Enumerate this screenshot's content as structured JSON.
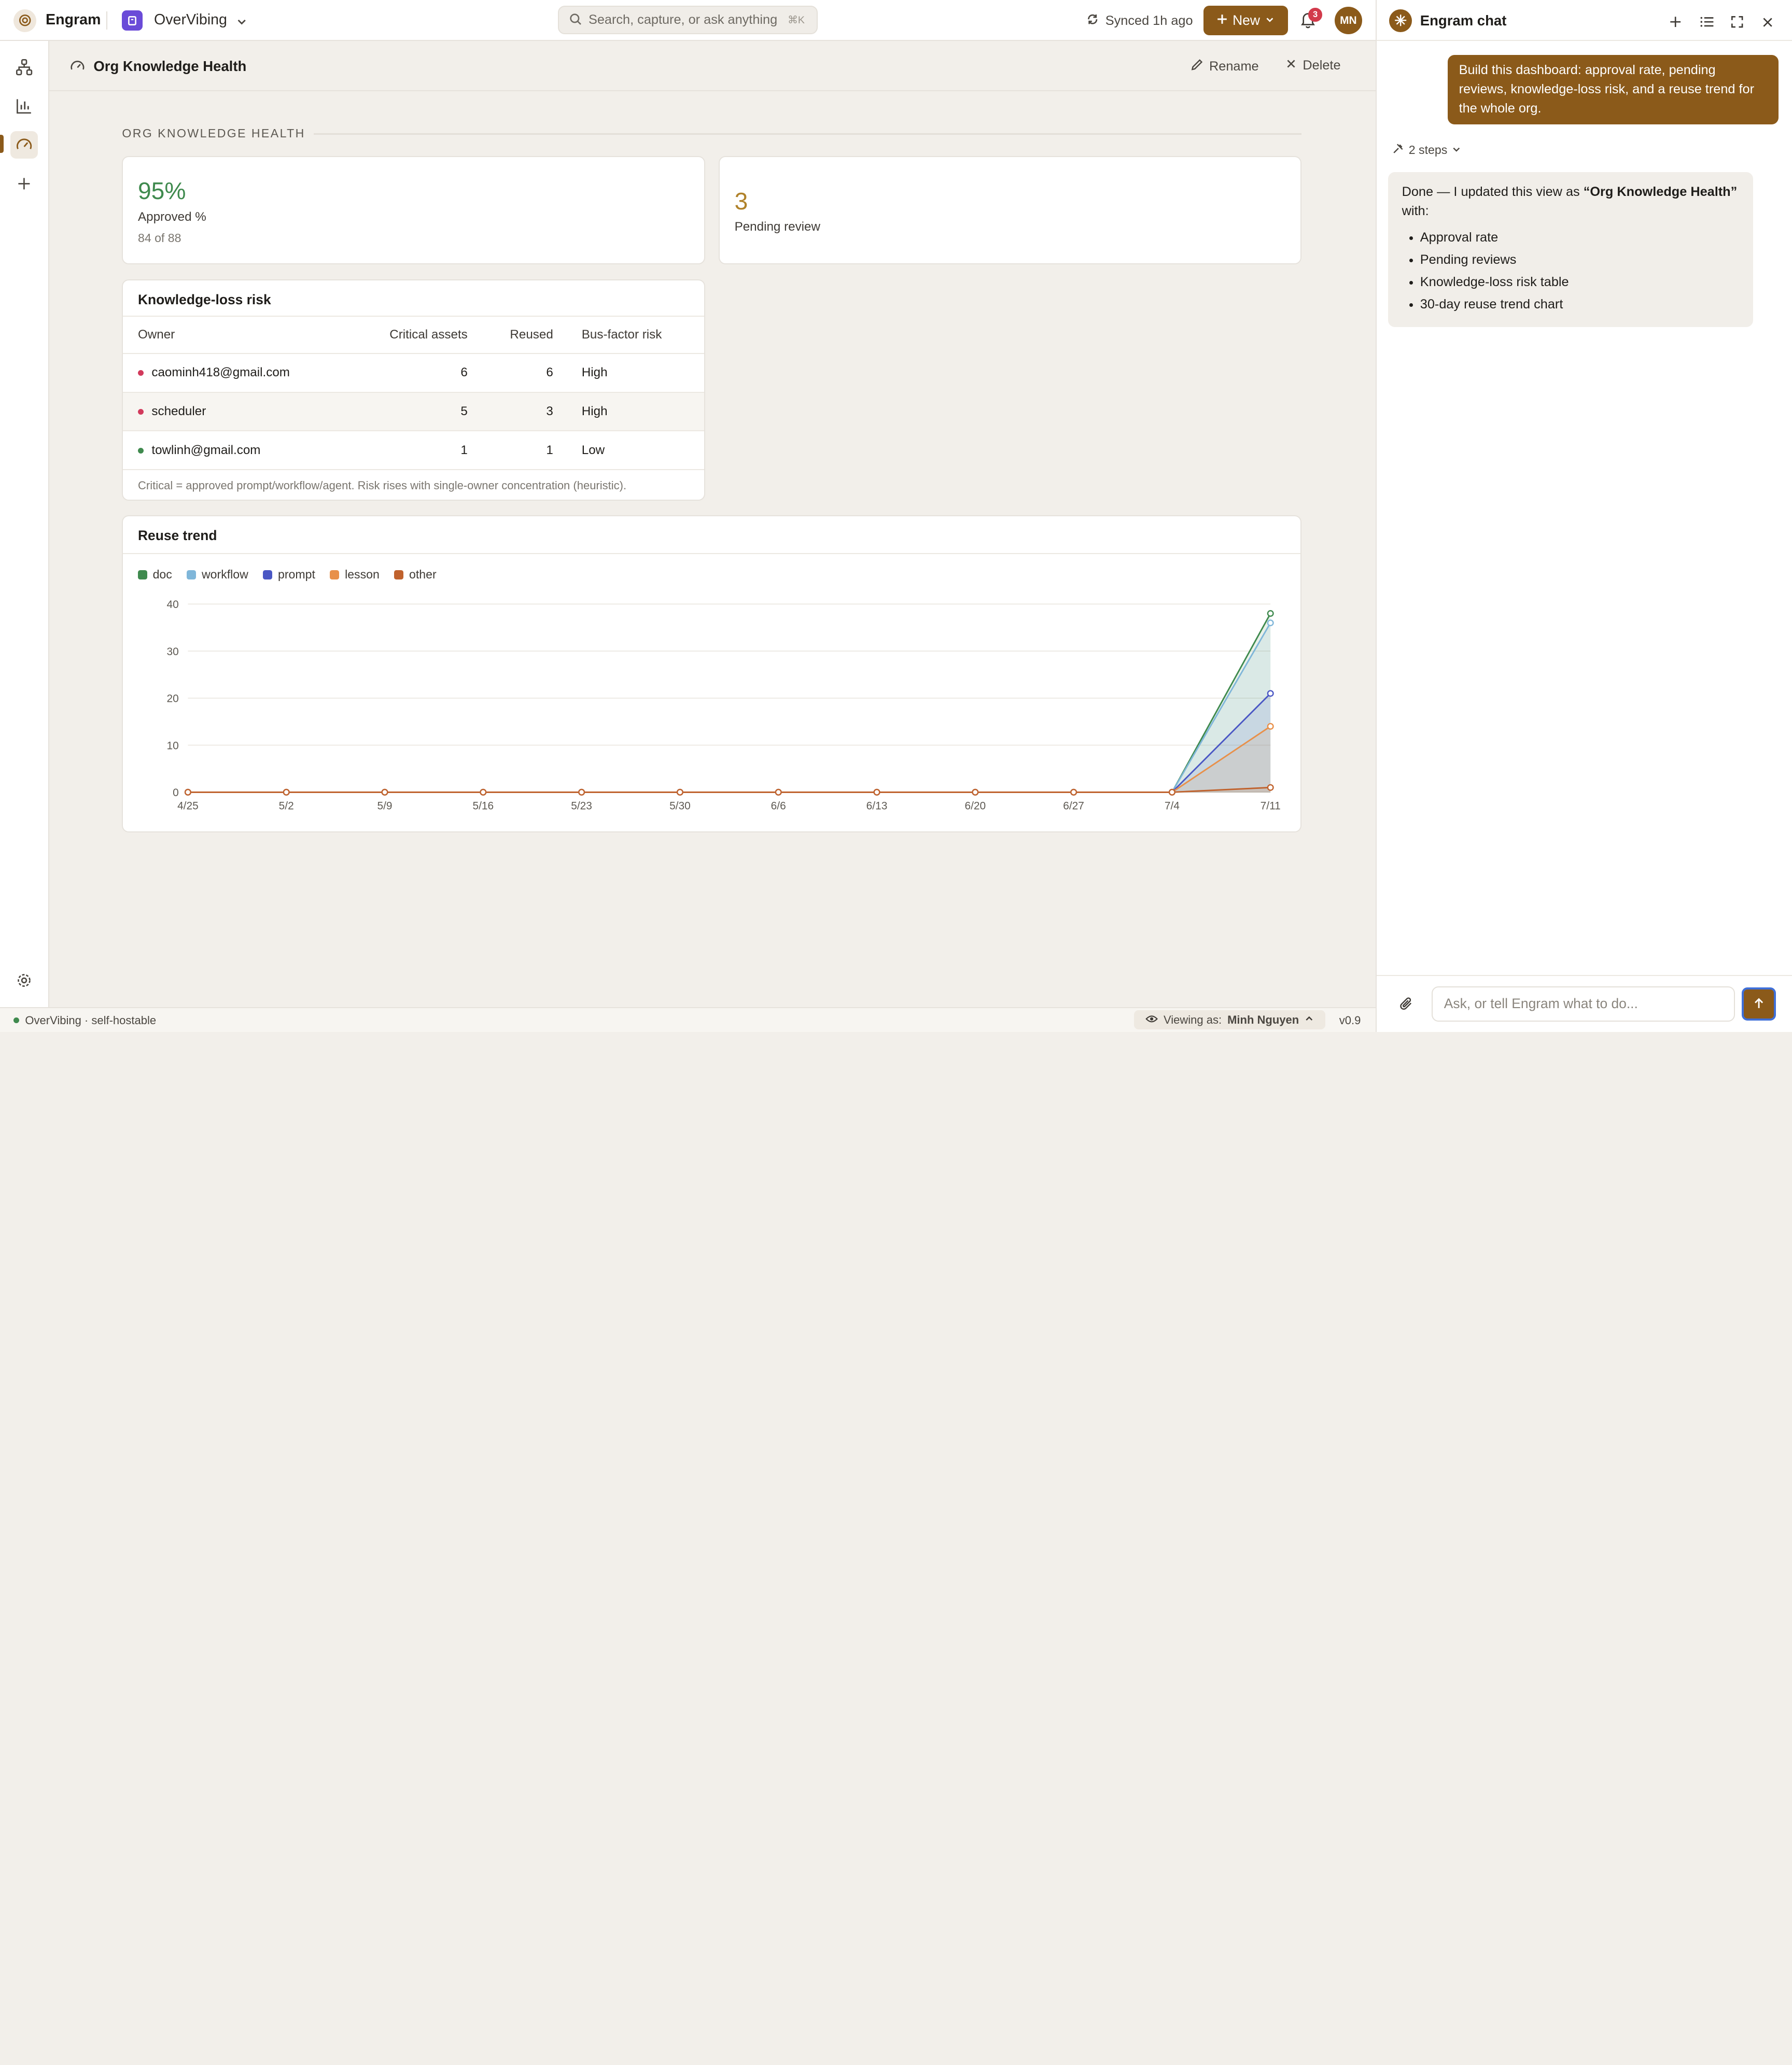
{
  "topbar": {
    "brand": "Engram",
    "workspace": "OverVibing",
    "search_placeholder": "Search, capture, or ask anything",
    "search_shortcut": "⌘K",
    "sync_status": "Synced 1h ago",
    "new_label": "New",
    "notification_count": "3",
    "avatar_initials": "MN"
  },
  "page": {
    "title": "Org Knowledge Health",
    "rename_label": "Rename",
    "delete_label": "Delete",
    "section_label": "ORG KNOWLEDGE HEALTH"
  },
  "kpis": {
    "approved": {
      "value": "95%",
      "label": "Approved %",
      "sub": "84 of 88",
      "color": "#3f8a4e"
    },
    "pending": {
      "value": "3",
      "label": "Pending review",
      "color": "#b0822a"
    }
  },
  "risk": {
    "title": "Knowledge-loss risk",
    "columns": [
      "Owner",
      "Critical assets",
      "Reused",
      "Bus-factor risk"
    ],
    "rows": [
      {
        "owner": "caominh418@gmail.com",
        "critical": "6",
        "reused": "6",
        "risk": "High",
        "dot": "#d23a5c"
      },
      {
        "owner": "scheduler",
        "critical": "5",
        "reused": "3",
        "risk": "High",
        "dot": "#d23a5c"
      },
      {
        "owner": "towlinh@gmail.com",
        "critical": "1",
        "reused": "1",
        "risk": "Low",
        "dot": "#3f8a4e"
      }
    ],
    "note": "Critical = approved prompt/workflow/agent. Risk rises with single-owner concentration (heuristic)."
  },
  "reuse": {
    "title": "Reuse trend"
  },
  "chart_data": {
    "type": "line",
    "title": "Reuse trend",
    "x": [
      "4/25",
      "5/2",
      "5/9",
      "5/16",
      "5/23",
      "5/30",
      "6/6",
      "6/13",
      "6/20",
      "6/27",
      "7/4",
      "7/11"
    ],
    "ylim": [
      0,
      40
    ],
    "yticks": [
      0,
      10,
      20,
      30,
      40
    ],
    "grid": true,
    "legend": "top-left",
    "series": [
      {
        "name": "doc",
        "color": "#3f8a4e",
        "values": [
          0,
          0,
          0,
          0,
          0,
          0,
          0,
          0,
          0,
          0,
          0,
          38
        ]
      },
      {
        "name": "workflow",
        "color": "#7fb6d9",
        "values": [
          0,
          0,
          0,
          0,
          0,
          0,
          0,
          0,
          0,
          0,
          0,
          36
        ]
      },
      {
        "name": "prompt",
        "color": "#4a57c4",
        "values": [
          0,
          0,
          0,
          0,
          0,
          0,
          0,
          0,
          0,
          0,
          0,
          21
        ]
      },
      {
        "name": "lesson",
        "color": "#e8904a",
        "values": [
          0,
          0,
          0,
          0,
          0,
          0,
          0,
          0,
          0,
          0,
          0,
          14
        ]
      },
      {
        "name": "other",
        "color": "#c0622d",
        "values": [
          0,
          0,
          0,
          0,
          0,
          0,
          0,
          0,
          0,
          0,
          0,
          1
        ]
      }
    ]
  },
  "status": {
    "left": "OverVibing · self-hostable",
    "viewing_label": "Viewing as:",
    "viewing_user": "Minh Nguyen",
    "version": "v0.9"
  },
  "chat": {
    "title": "Engram chat",
    "user_message": "Build this dashboard: approval rate, pending reviews, knowledge-loss risk, and a reuse trend for the whole org.",
    "steps_label": "2 steps",
    "ai_intro_pre": "Done — I updated this view as ",
    "ai_intro_bold": "“Org Knowledge Health”",
    "ai_intro_post": " with:",
    "ai_items": [
      "Approval rate",
      "Pending reviews",
      "Knowledge-loss risk table",
      "30-day reuse trend chart"
    ],
    "input_placeholder": "Ask, or tell Engram what to do..."
  }
}
